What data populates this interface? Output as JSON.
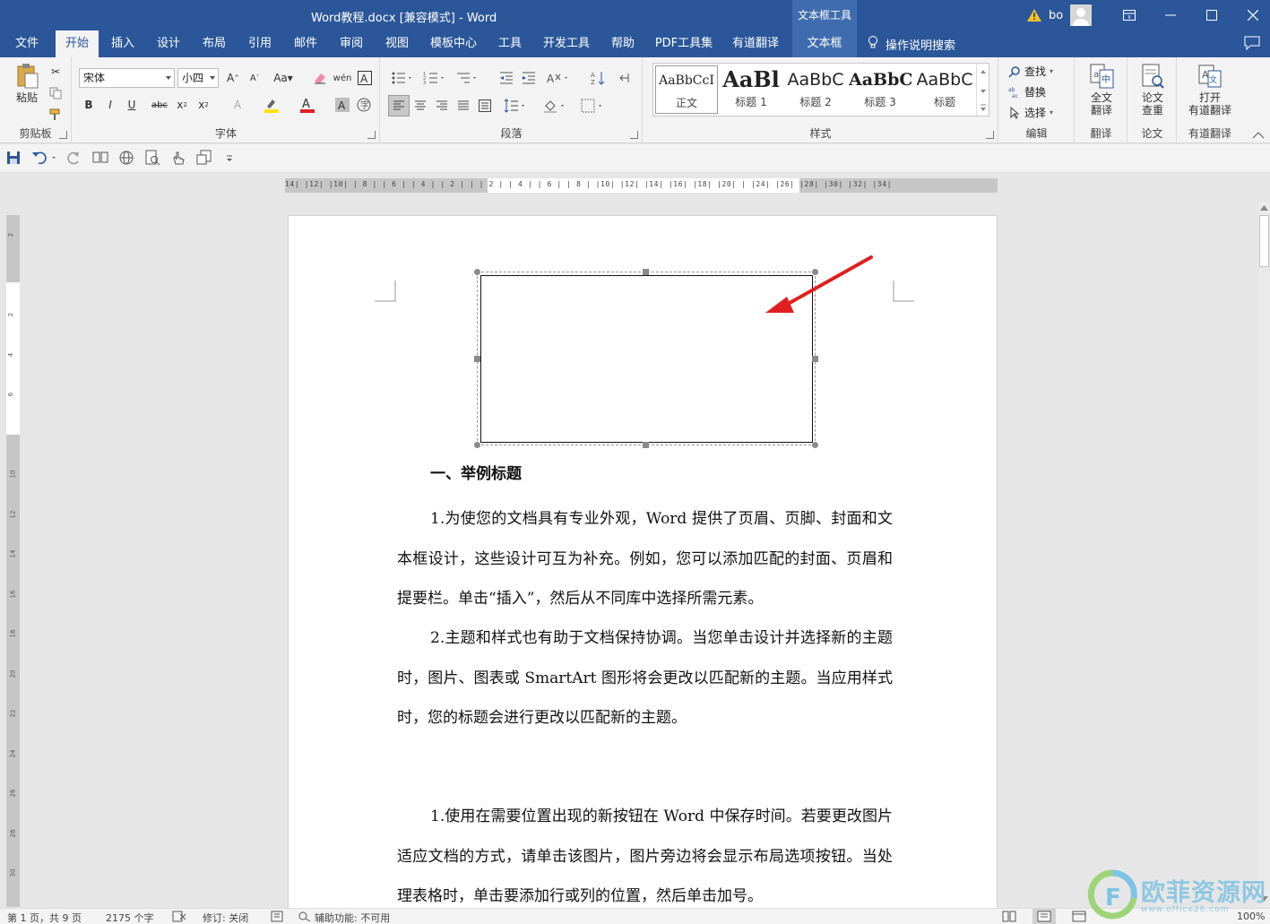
{
  "window": {
    "title": "Word教程.docx [兼容模式]  -  Word",
    "context_tool_label": "文本框工具",
    "user_name": "bo"
  },
  "tabs": [
    "文件",
    "开始",
    "插入",
    "设计",
    "布局",
    "引用",
    "邮件",
    "审阅",
    "视图",
    "模板中心",
    "工具",
    "开发工具",
    "帮助",
    "PDF工具集",
    "有道翻译",
    "文本框"
  ],
  "tell_me": "操作说明搜索",
  "ribbon": {
    "clipboard": {
      "paste": "粘贴",
      "label": "剪贴板"
    },
    "font": {
      "name": "宋体",
      "size": "小四",
      "label": "字体"
    },
    "paragraph": {
      "label": "段落"
    },
    "styles": {
      "label": "样式",
      "items": [
        {
          "sample": "AaBbCcI",
          "name": "正文"
        },
        {
          "sample": "AaBl",
          "name": "标题 1"
        },
        {
          "sample": "AaBbC",
          "name": "标题 2"
        },
        {
          "sample": "AaBbC",
          "name": "标题 3"
        },
        {
          "sample": "AaBbC",
          "name": "标题"
        }
      ]
    },
    "editing": {
      "find": "查找",
      "replace": "替换",
      "select": "选择",
      "label": "编辑"
    },
    "translate": {
      "full_line1": "全文",
      "full_line2": "翻译",
      "label": "翻译"
    },
    "paper": {
      "check_line1": "论文",
      "check_line2": "查重",
      "label": "论文"
    },
    "youdao": {
      "open_line1": "打开",
      "open_line2": "有道翻译",
      "label": "有道翻译"
    }
  },
  "ruler": {
    "h": "14|  |12|  |10|  | 8 |  | 6 |  | 4 |  | 2 |  |    | 2 |  | 4 |  | 6 |  | 8 |  |10|  |12|  |14|  |16|  |18|  |20|  |    |24|  |26|  |28|  |30|  |32|  |34|",
    "v": [
      "2",
      "",
      "2",
      "4",
      "6",
      "",
      "10",
      "12",
      "14",
      "16",
      "18",
      "20",
      "22",
      "24",
      "26",
      "28",
      "30"
    ]
  },
  "document": {
    "heading": "一、举例标题",
    "paragraphs": [
      "1.为使您的文档具有专业外观，Word 提供了页眉、页脚、封面和文本框设计，这些设计可互为补充。例如，您可以添加匹配的封面、页眉和提要栏。单击“插入”，然后从不同库中选择所需元素。",
      "2.主题和样式也有助于文档保持协调。当您单击设计并选择新的主题时，图片、图表或 SmartArt 图形将会更改以匹配新的主题。当应用样式时，您的标题会进行更改以匹配新的主题。",
      "1.使用在需要位置出现的新按钮在 Word 中保存时间。若要更改图片适应文档的方式，请单击该图片，图片旁边将会显示布局选项按钮。当处理表格时，单击要添加行或列的位置，然后单击加号。"
    ]
  },
  "status": {
    "page": "第 1 页，共 9 页",
    "words": "2175 个字",
    "track": "修订: 关闭",
    "accessibility": "辅助功能: 不可用",
    "zoom": "100%"
  },
  "watermark": {
    "text": "欧菲资源网",
    "url": "www.office26.com"
  },
  "colors": {
    "brand": "#2b579a",
    "context_tab": "#3f6cae",
    "arrow": "#e02020"
  }
}
